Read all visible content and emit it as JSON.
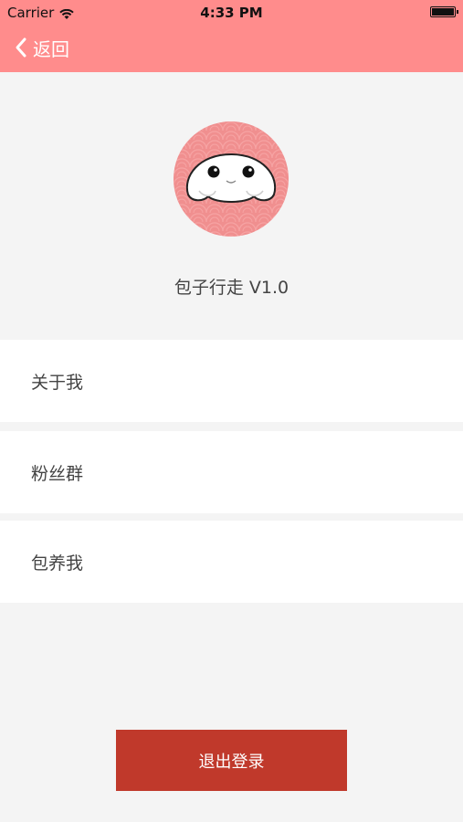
{
  "status_bar": {
    "carrier": "Carrier",
    "time": "4:33 PM",
    "icons": [
      "wifi-icon",
      "battery-icon"
    ]
  },
  "nav": {
    "back_label": "返回",
    "back_icon": "chevron-left-icon",
    "bar_color": "#ff8c8c"
  },
  "profile": {
    "avatar_icon": "bun-mascot-avatar",
    "version_text": "包子行走 V1.0"
  },
  "menu": {
    "items": [
      {
        "label": "关于我"
      },
      {
        "label": "粉丝群"
      },
      {
        "label": "包养我"
      }
    ]
  },
  "logout": {
    "label": "退出登录",
    "color": "#c0392b"
  }
}
